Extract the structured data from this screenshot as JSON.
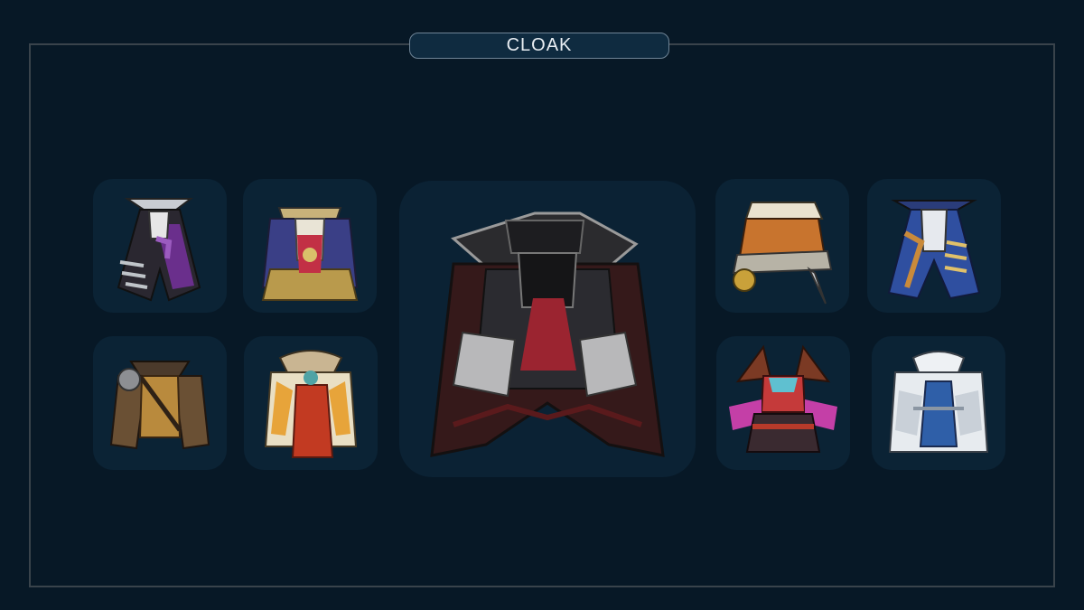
{
  "category": {
    "title": "CLOAK"
  },
  "colors": {
    "background": "#071826",
    "slot": "#0b2335",
    "frame": "#39434b",
    "pill_border": "#6f8496"
  },
  "selected_item": {
    "icon": "black-highcollar-cloak-icon"
  },
  "items": [
    {
      "icon": "dark-armored-coat-icon"
    },
    {
      "icon": "royal-caped-vestment-icon"
    },
    {
      "icon": "brown-leather-jacket-icon"
    },
    {
      "icon": "hooded-red-robe-icon"
    },
    {
      "icon": "wrapped-bandit-garb-icon"
    },
    {
      "icon": "blue-pirate-coat-icon"
    },
    {
      "icon": "bat-winged-outfit-icon"
    },
    {
      "icon": "white-hooded-robe-icon"
    }
  ]
}
